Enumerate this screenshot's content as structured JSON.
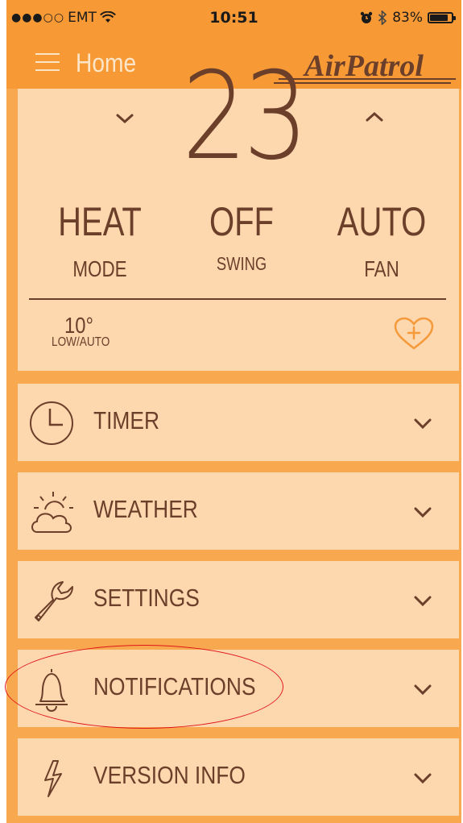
{
  "status_bar": {
    "signal": "●●●○○",
    "carrier": "EMT",
    "time": "10:51",
    "battery_percent": "83%",
    "battery_level": 0.83
  },
  "nav": {
    "title": "Home",
    "logo_text": "AirPatrol"
  },
  "climate": {
    "temperature": "23",
    "mode_value": "HEAT",
    "mode_label": "MODE",
    "swing_value": "OFF",
    "swing_label": "SWING",
    "fan_value": "AUTO",
    "fan_label": "FAN",
    "setpoint_value": "10°",
    "setpoint_label": "LOW/AUTO"
  },
  "menu": {
    "items": [
      {
        "label": "TIMER",
        "icon": "clock-icon"
      },
      {
        "label": "WEATHER",
        "icon": "weather-icon"
      },
      {
        "label": "SETTINGS",
        "icon": "wrench-icon"
      },
      {
        "label": "NOTIFICATIONS",
        "icon": "bell-icon"
      },
      {
        "label": "VERSION INFO",
        "icon": "lightning-icon"
      }
    ]
  },
  "colors": {
    "background": "#f8a94f",
    "header": "#f79a36",
    "card": "#fdd7ae",
    "text": "#6b3f2a",
    "annotation": "#e0141a"
  }
}
